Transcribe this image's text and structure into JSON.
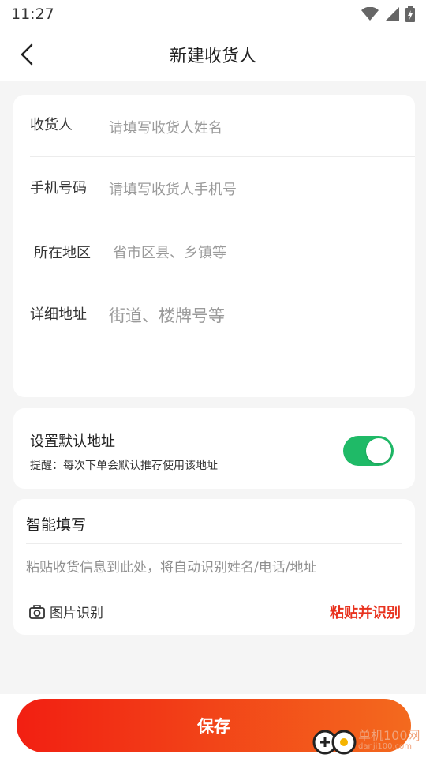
{
  "status_bar": {
    "time": "11:27"
  },
  "nav": {
    "title": "新建收货人"
  },
  "form": {
    "receiver": {
      "label": "收货人",
      "placeholder": "请填写收货人姓名"
    },
    "phone": {
      "label": "手机号码",
      "placeholder": "请填写收货人手机号"
    },
    "region": {
      "label": "所在地区",
      "placeholder": "省市区县、乡镇等"
    },
    "address": {
      "label": "详细地址",
      "placeholder": "街道、楼牌号等"
    }
  },
  "default_address": {
    "title": "设置默认地址",
    "hint": "提醒：每次下单会默认推荐使用该地址",
    "enabled": true
  },
  "smart_fill": {
    "title": "智能填写",
    "placeholder": "粘贴收货信息到此处，将自动识别姓名/电话/地址",
    "image_recognize": "图片识别",
    "paste_recognize": "粘贴并识别"
  },
  "save_label": "保存",
  "watermark": {
    "main": "单机100网",
    "sub": "danji100.com"
  },
  "colors": {
    "accent": "#e8321e",
    "toggle_on": "#1fba67"
  }
}
